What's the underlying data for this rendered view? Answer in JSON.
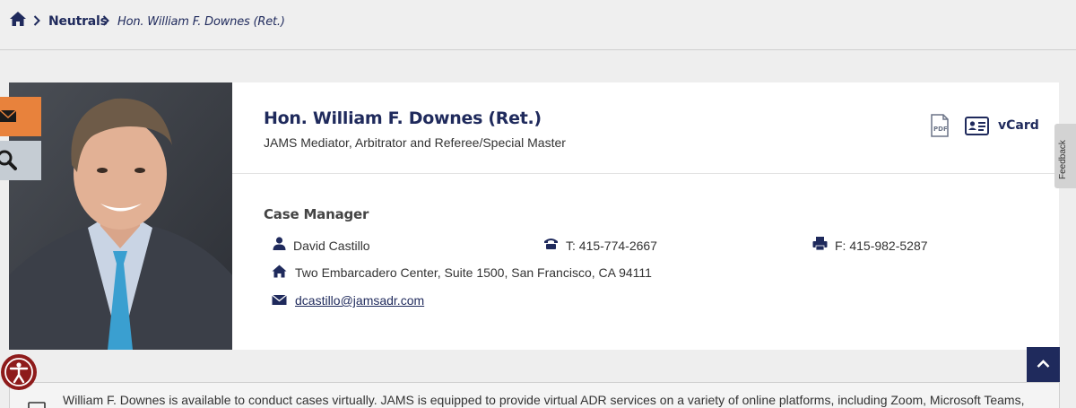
{
  "breadcrumb": {
    "home_icon": "home-icon",
    "link": "Neutrals",
    "current": "Hon. William F. Downes (Ret.)"
  },
  "profile": {
    "name": "Hon. William F. Downes (Ret.)",
    "title": "JAMS Mediator, Arbitrator and Referee/Special Master",
    "pdf_icon": "pdf-icon",
    "vcard_label": "vCard"
  },
  "case_manager": {
    "heading": "Case Manager",
    "name": "David Castillo",
    "phone": "T: 415-774-2667",
    "fax": "F: 415-982-5287",
    "address": "Two Embarcadero Center, Suite 1500, San Francisco, CA 94111",
    "email": "dcastillo@jamsadr.com"
  },
  "side_tabs": [
    "mail-icon",
    "search-icon"
  ],
  "feedback_label": "Feedback",
  "notice": {
    "text": "William F. Downes is available to conduct cases virtually. JAMS is equipped to provide virtual ADR services on a variety of online platforms, including Zoom, Microsoft Teams,"
  },
  "colors": {
    "brand_navy": "#1f2a5c",
    "accent_orange": "#e8823c",
    "accessibility_red": "#8e1b1b"
  }
}
